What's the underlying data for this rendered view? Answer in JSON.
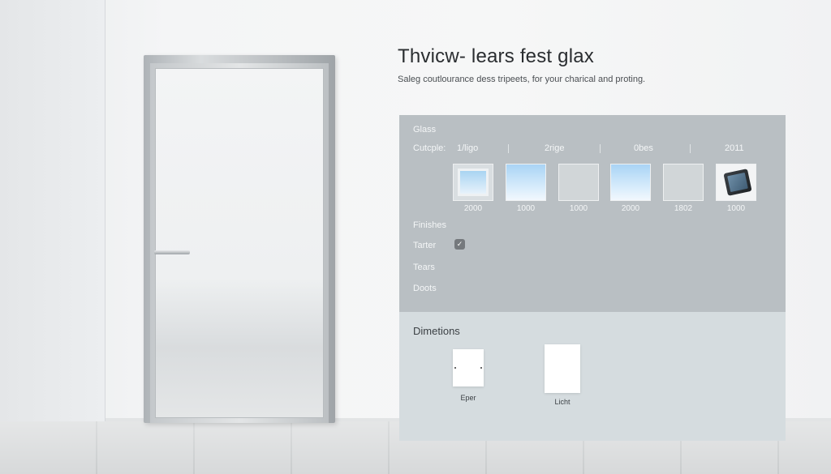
{
  "header": {
    "title": "Thvicw- lears fest glax",
    "subtitle": "Saleg coutlourance dess tripeets, for your charical and proting."
  },
  "panel": {
    "glass_label": "Glass",
    "cutouts": {
      "label": "Cutcple:",
      "options": [
        "1/ligo",
        "2rige",
        "0bes",
        "2011"
      ]
    },
    "swatches": [
      {
        "name": "clear-frame",
        "value": "2000"
      },
      {
        "name": "blue-tint",
        "value": "1000"
      },
      {
        "name": "frosted",
        "value": "1000"
      },
      {
        "name": "blue-gradient",
        "value": "2000"
      },
      {
        "name": "frosted-light",
        "value": "1802"
      },
      {
        "name": "tablet",
        "value": "1000"
      }
    ],
    "finishes_label": "Finishes",
    "finish_items": [
      "Tarter",
      "Tears",
      "Doots"
    ],
    "dimensions": {
      "label": "Dimetions",
      "options": [
        "Eper",
        "Licht"
      ]
    }
  },
  "colors": {
    "panel_top": "#b9bfc3",
    "panel_bottom": "#d5dcdf",
    "glass_blue": "#a9d4f5"
  }
}
